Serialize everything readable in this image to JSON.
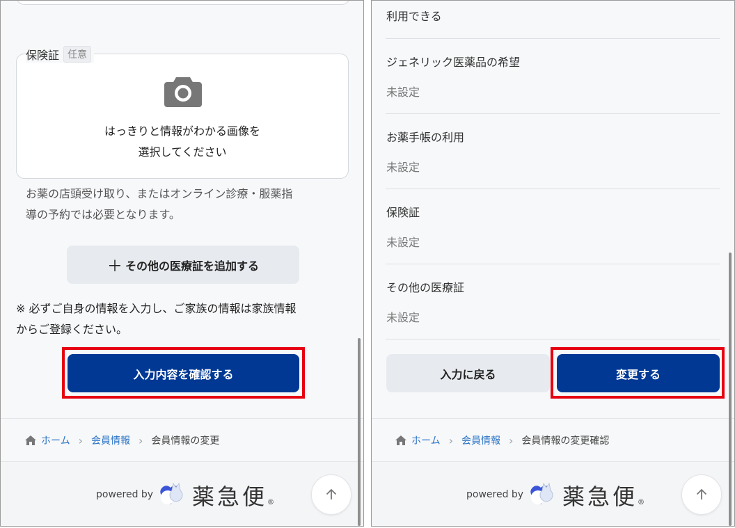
{
  "left": {
    "insurance_label": "保険証",
    "optional_tag": "任意",
    "upload_line1": "はっきりと情報がわかる画像を",
    "upload_line2": "選択してください",
    "help_line1": "お薬の店頭受け取り、またはオンライン診療・服薬指",
    "help_line2": "導の予約では必要となります。",
    "add_button_plus": "＋",
    "add_button_label": "その他の医療証を追加する",
    "note_line1": "※ 必ずご自身の情報を入力し、ご家族の情報は家族情報",
    "note_line2": "からご登録ください。",
    "confirm_button": "入力内容を確認する",
    "breadcrumb": {
      "home": "ホーム",
      "member": "会員情報",
      "current": "会員情報の変更"
    }
  },
  "right": {
    "top_text": "利用できる",
    "rows": [
      {
        "label": "ジェネリック医薬品の希望",
        "value": "未設定"
      },
      {
        "label": "お薬手帳の利用",
        "value": "未設定"
      },
      {
        "label": "保険証",
        "value": "未設定"
      },
      {
        "label": "その他の医療証",
        "value": "未設定"
      }
    ],
    "back_button": "入力に戻る",
    "submit_button": "変更する",
    "breadcrumb": {
      "home": "ホーム",
      "member": "会員情報",
      "current": "会員情報の変更確認"
    }
  },
  "footer": {
    "powered_by": "powered by",
    "logo_text": "薬急便",
    "logo_reg": "®"
  },
  "colors": {
    "primary": "#003894",
    "highlight": "#e60012",
    "link": "#2a73c5"
  },
  "icons": [
    "camera-icon",
    "plus-icon",
    "home-icon",
    "chevron-right-icon",
    "arrow-up-icon",
    "logo-mark-icon"
  ]
}
